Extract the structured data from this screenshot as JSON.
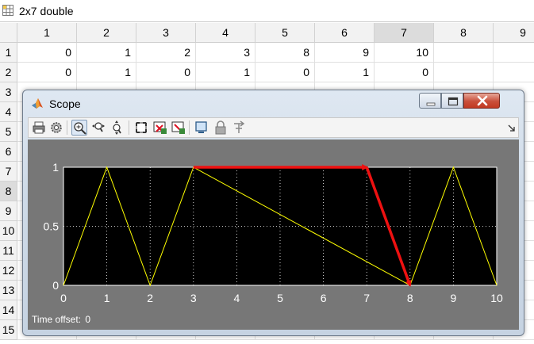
{
  "editor": {
    "title": "2x7 double",
    "columns": [
      "1",
      "2",
      "3",
      "4",
      "5",
      "6",
      "7",
      "8",
      "9"
    ],
    "selected_column": "7",
    "selected_row": "8",
    "rows": [
      "1",
      "2",
      "3",
      "4",
      "5",
      "6",
      "7",
      "8",
      "9",
      "10",
      "11",
      "12",
      "13",
      "14",
      "15"
    ],
    "data": [
      [
        "0",
        "1",
        "2",
        "3",
        "8",
        "9",
        "10"
      ],
      [
        "0",
        "1",
        "0",
        "1",
        "0",
        "1",
        "0"
      ]
    ]
  },
  "scope": {
    "title": "Scope",
    "time_offset_label": "Time offset:",
    "time_offset_value": "0",
    "toolbar": [
      "print-icon",
      "parameters-icon",
      "zoom-in-icon",
      "zoom-x-icon",
      "zoom-y-icon",
      "autoscale-icon",
      "save-axes-icon",
      "restore-axes-icon",
      "floating-scope-icon",
      "lock-icon",
      "signal-select-icon"
    ],
    "colors": {
      "signal": "#ffff00",
      "annotation": "#ee1111",
      "plot_bg": "#000000",
      "frame": "#777777"
    }
  },
  "chart_data": {
    "type": "line",
    "x": [
      0,
      1,
      2,
      3,
      8,
      9,
      10
    ],
    "y": [
      0,
      1,
      0,
      1,
      0,
      1,
      0
    ],
    "xlim": [
      0,
      10
    ],
    "ylim": [
      0,
      1
    ],
    "xticks": [
      "0",
      "1",
      "2",
      "3",
      "4",
      "5",
      "6",
      "7",
      "8",
      "9",
      "10"
    ],
    "yticks": [
      "0",
      "0.5",
      "1"
    ],
    "grid": true,
    "annotations": [
      {
        "from": [
          3,
          1
        ],
        "to": [
          7,
          1
        ]
      },
      {
        "from": [
          7,
          1
        ],
        "to": [
          8,
          0
        ]
      }
    ]
  }
}
